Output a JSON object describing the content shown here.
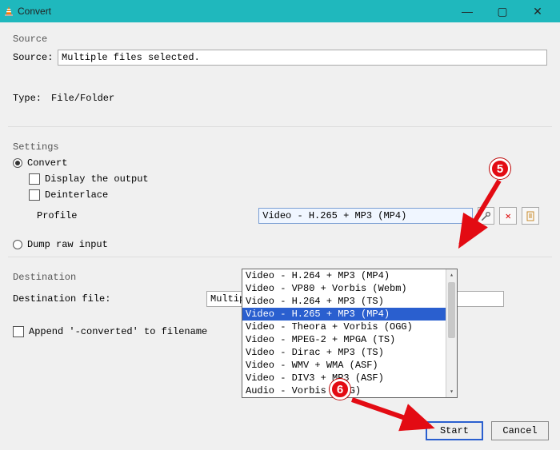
{
  "window": {
    "title": "Convert",
    "minimize": "—",
    "maximize": "▢",
    "close": "✕"
  },
  "source": {
    "group_label": "Source",
    "source_label": "Source:",
    "source_value": "Multiple files selected.",
    "type_label": "Type:",
    "type_value": "File/Folder"
  },
  "settings": {
    "group_label": "Settings",
    "convert_label": "Convert",
    "display_output_label": "Display the output",
    "deinterlace_label": "Deinterlace",
    "profile_label": "Profile",
    "profile_selected": "Video - H.265 + MP3 (MP4)",
    "profile_options": [
      "Video - H.264 + MP3 (MP4)",
      "Video - VP80 + Vorbis (Webm)",
      "Video - H.264 + MP3 (TS)",
      "Video - H.265 + MP3 (MP4)",
      "Video - Theora + Vorbis (OGG)",
      "Video - MPEG-2 + MPGA (TS)",
      "Video - Dirac + MP3 (TS)",
      "Video - WMV + WMA (ASF)",
      "Video - DIV3 + MP3 (ASF)",
      "Audio - Vorbis (OGG)"
    ],
    "profile_selected_index": 3,
    "dump_raw_label": "Dump raw input",
    "tool_icon": "wrench-icon",
    "delete_icon": "x-icon",
    "new_icon": "new-profile-icon"
  },
  "destination": {
    "group_label": "Destination",
    "file_label": "Destination file:",
    "file_value": "Multiple Fil",
    "append_label": "Append '-converted' to filename"
  },
  "footer": {
    "start": "Start",
    "cancel": "Cancel"
  },
  "annotations": {
    "badge5": "5",
    "badge6": "6"
  }
}
